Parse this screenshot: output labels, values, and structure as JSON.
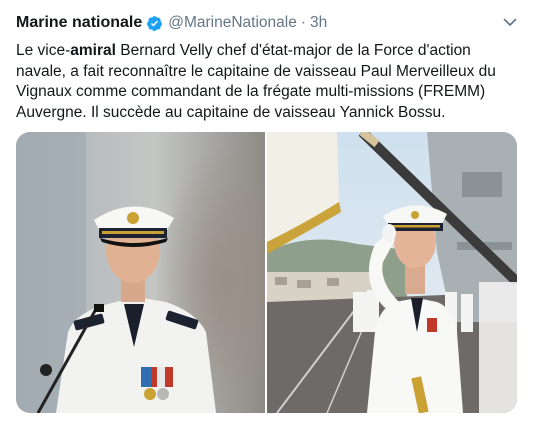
{
  "tweet": {
    "display_name": "Marine nationale",
    "handle": "@MarineNationale",
    "separator": "·",
    "time": "3h",
    "text_before": "Le vice-",
    "text_bold": "amiral",
    "text_after": " Bernard Velly chef d'état-major de la Force d'action navale, a fait reconnaître le capitaine de vaisseau Paul Merveilleux du Vignaux comme commandant de la frégate multi-missions (FREMM) Auvergne. Il succède au capitaine de vaisseau Yannick Bossu."
  },
  "icons": {
    "verified": "verified-badge-icon",
    "caret": "chevron-down-icon"
  },
  "colors": {
    "text": "#14171a",
    "secondary": "#657786",
    "verified": "#1da1f2"
  }
}
